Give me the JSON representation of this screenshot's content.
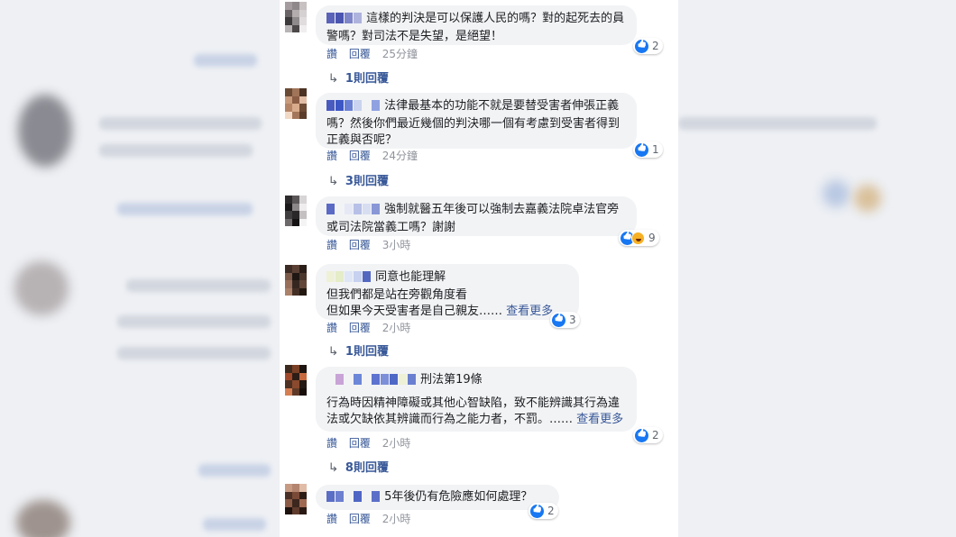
{
  "comments": [
    {
      "text": "這樣的判決是可以保護人民的嗎？對的起死去的員警嗎？對司法不是失望，是絕望！",
      "actions": {
        "like": "讚",
        "reply": "回覆",
        "time": "25分鐘"
      },
      "reaction_count": "2",
      "reactions": [
        "like-icon"
      ],
      "replies": "1則回覆"
    },
    {
      "text": "法律最基本的功能不就是要替受害者伸張正義嗎？然後你們最近幾個的判決哪一個有考慮到受害者得到正義與否呢？",
      "actions": {
        "like": "讚",
        "reply": "回覆",
        "time": "24分鐘"
      },
      "reaction_count": "1",
      "reactions": [
        "like-icon"
      ],
      "replies": "3則回覆"
    },
    {
      "text": "強制就醫五年後可以強制去嘉義法院卓法官旁或司法院當義工嗎？謝謝",
      "actions": {
        "like": "讚",
        "reply": "回覆",
        "time": "3小時"
      },
      "reaction_count": "9",
      "reactions": [
        "like-icon",
        "haha-icon"
      ]
    },
    {
      "text_line1": "同意也能理解",
      "text_rest": "但我們都是站在旁觀角度看\n但如果今天受害者是自己親友……",
      "see_more": "查看更多",
      "actions": {
        "like": "讚",
        "reply": "回覆",
        "time": "2小時"
      },
      "reaction_count": "3",
      "reactions": [
        "like-icon"
      ],
      "replies": "1則回覆"
    },
    {
      "text_line1": "刑法第19條",
      "text_rest": "行為時因精神障礙或其他心智缺陷，致不能辨識其行為違法或欠缺依其辨識而行為之能力者，不罰。……",
      "see_more": "查看更多",
      "actions": {
        "like": "讚",
        "reply": "回覆",
        "time": "2小時"
      },
      "reaction_count": "2",
      "reactions": [
        "like-icon"
      ],
      "replies": "8則回覆"
    },
    {
      "text": "5年後仍有危險應如何處理？",
      "actions": {
        "like": "讚",
        "reply": "回覆",
        "time": "2小時"
      },
      "reaction_count": "2",
      "reactions": [
        "like-icon"
      ]
    }
  ],
  "colors": {
    "link": "#385898",
    "bubble": "#f2f3f5",
    "timestamp": "#90949c",
    "like_blue": "#1877f2",
    "side_background": "#eef0f4"
  }
}
